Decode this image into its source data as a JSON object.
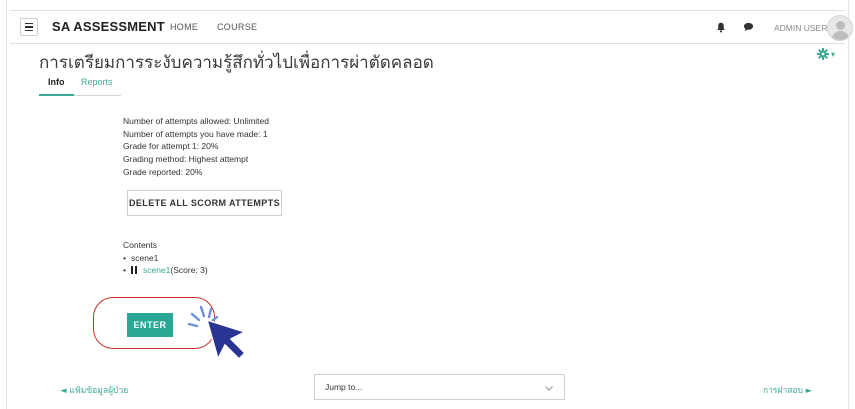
{
  "navbar": {
    "brand": "SA ASSESSMENT",
    "home_label": "HOME",
    "course_label": "COURSE",
    "user_label": "ADMIN USER"
  },
  "page": {
    "title": "การเตรียมการระงับความรู้สึกทั่วไปเพื่อการผ่าตัดคลอด"
  },
  "tabs": [
    {
      "label": "Info",
      "active": true
    },
    {
      "label": "Reports",
      "active": false
    }
  ],
  "info": {
    "attempts_allowed": "Number of attempts allowed: Unlimited",
    "attempts_made": "Number of attempts you have made: 1",
    "grade_attempt": "Grade for attempt 1: 20%",
    "grading_method": "Grading method: Highest attempt",
    "grade_reported": "Grade reported: 20%"
  },
  "delete_button_label": "DELETE ALL SCORM ATTEMPTS",
  "contents": {
    "heading": "Contents",
    "items": [
      {
        "label": "scene1"
      },
      {
        "link_label": "scene1",
        "score": "(Score: 3)"
      }
    ]
  },
  "enter_button_label": "ENTER",
  "footer": {
    "prev_label": "◄ แฟ้มข้อมูลผู้ป่วย",
    "jump_label": "Jump to...",
    "next_label": "การฝาสอบ ►"
  },
  "colors": {
    "accent": "#3aaa95",
    "enter_button": "#2aa795",
    "highlight_ring": "#c8332c",
    "cursor": "#283593",
    "burst": "#6a8fd6"
  },
  "icons": {
    "menu": "hamburger-icon",
    "notifications": "bell-icon",
    "messages": "chat-icon",
    "settings": "gear-icon",
    "dropdown": "chevron-down-icon",
    "pointer": "cursor-arrow-icon"
  }
}
